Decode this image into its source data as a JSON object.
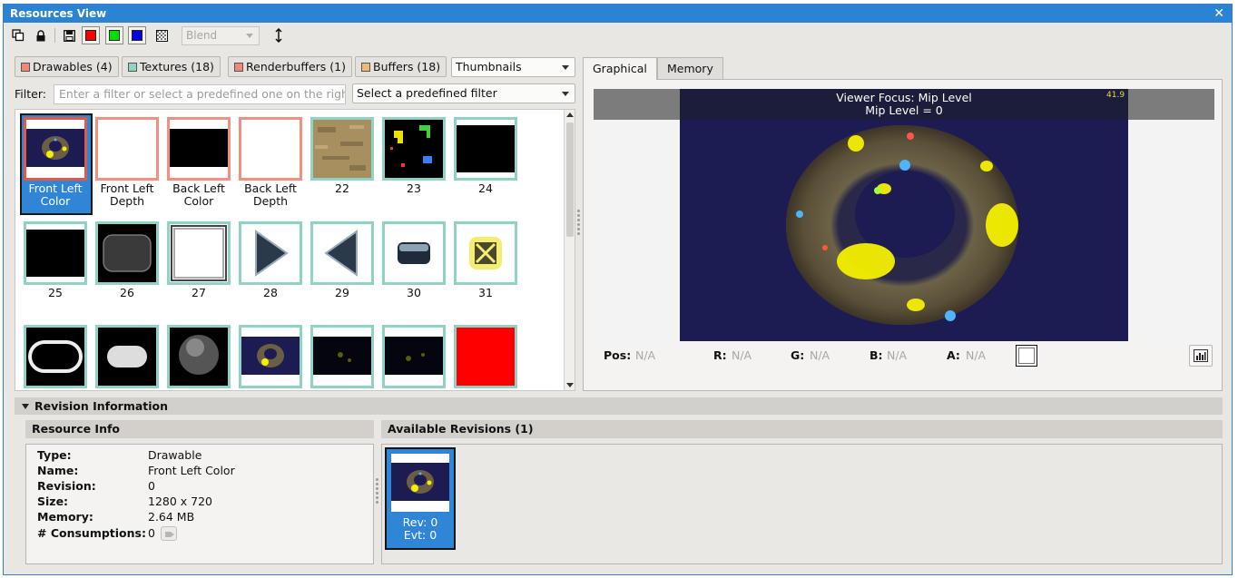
{
  "window": {
    "title": "Resources View",
    "close_glyph": "✕"
  },
  "toolbar": {
    "blend_select": "Blend",
    "channel_colors": {
      "red": "#ff0000",
      "green": "#00e000",
      "blue": "#0000e0"
    }
  },
  "resource_tabs": [
    {
      "label": "Drawables (4)",
      "color": "#f08878"
    },
    {
      "label": "Textures (18)",
      "color": "#8fd3c6"
    },
    {
      "label": "Renderbuffers (1)",
      "color": "#f08878"
    },
    {
      "label": "Buffers (18)",
      "color": "#f2b87a"
    }
  ],
  "view_mode": "Thumbnails",
  "filter": {
    "label": "Filter:",
    "placeholder": "Enter a filter or select a predefined one on the right",
    "predefined": "Select a predefined filter"
  },
  "thumbnails": [
    {
      "label": "Front Left Color",
      "kind": "drawable",
      "selected": true
    },
    {
      "label": "Front Left Depth",
      "kind": "drawable"
    },
    {
      "label": "Back Left Color",
      "kind": "drawable"
    },
    {
      "label": "Back Left Depth",
      "kind": "drawable"
    },
    {
      "label": "22",
      "kind": "texture"
    },
    {
      "label": "23",
      "kind": "texture"
    },
    {
      "label": "24",
      "kind": "texture"
    },
    {
      "label": "25",
      "kind": "texture"
    },
    {
      "label": "26",
      "kind": "texture"
    },
    {
      "label": "27",
      "kind": "texture"
    },
    {
      "label": "28",
      "kind": "texture"
    },
    {
      "label": "29",
      "kind": "texture"
    },
    {
      "label": "30",
      "kind": "texture"
    },
    {
      "label": "31",
      "kind": "texture"
    },
    {
      "label": "",
      "kind": "texture"
    },
    {
      "label": "",
      "kind": "texture"
    },
    {
      "label": "",
      "kind": "texture"
    },
    {
      "label": "",
      "kind": "texture"
    },
    {
      "label": "",
      "kind": "texture"
    },
    {
      "label": "",
      "kind": "texture"
    },
    {
      "label": "",
      "kind": "texture"
    }
  ],
  "view_tabs": [
    {
      "label": "Graphical",
      "active": true
    },
    {
      "label": "Memory",
      "active": false
    }
  ],
  "viewer": {
    "overlay_line1": "Viewer Focus: Mip Level",
    "overlay_line2": "Mip Level = 0",
    "fps": "41.9"
  },
  "pixel": {
    "pos_label": "Pos:",
    "pos": "N/A",
    "r_label": "R:",
    "r": "N/A",
    "g_label": "G:",
    "g": "N/A",
    "b_label": "B:",
    "b": "N/A",
    "a_label": "A:",
    "a": "N/A"
  },
  "revision": {
    "section_title": "Revision Information",
    "info_title": "Resource Info",
    "available_title": "Available Revisions (1)",
    "info": [
      {
        "key": "Type:",
        "value": "Drawable"
      },
      {
        "key": "Name:",
        "value": "Front Left Color"
      },
      {
        "key": "Revision:",
        "value": "0"
      },
      {
        "key": "Size:",
        "value": "1280 x 720"
      },
      {
        "key": "Memory:",
        "value": "2.64 MB"
      },
      {
        "key": "# Consumptions:",
        "value": "0"
      }
    ],
    "items": [
      {
        "rev": "Rev: 0",
        "evt": "Evt: 0"
      }
    ]
  }
}
